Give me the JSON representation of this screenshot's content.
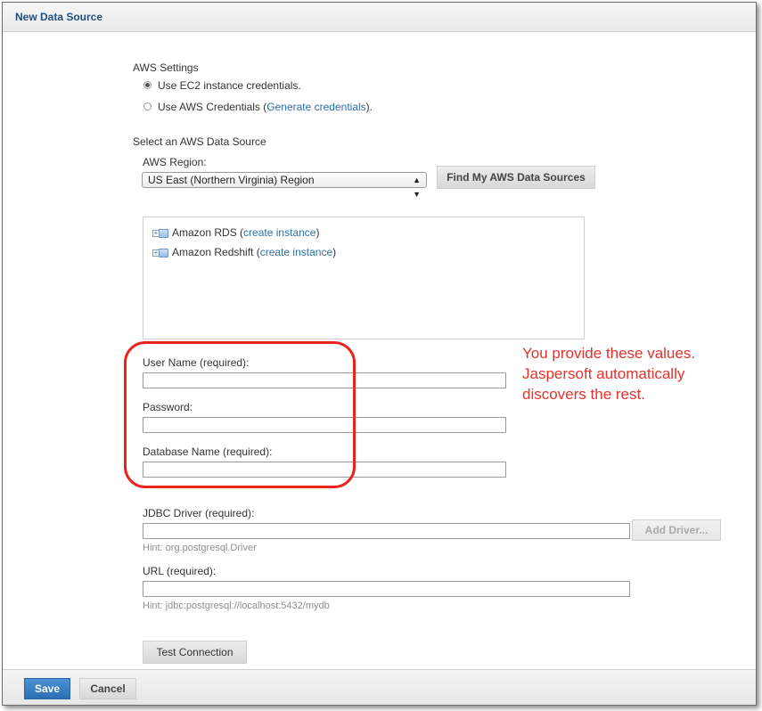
{
  "dialog": {
    "title": "New Data Source"
  },
  "aws_settings": {
    "heading": "AWS Settings",
    "options": [
      {
        "label": "Use EC2 instance credentials.",
        "checked": true
      },
      {
        "label_pre": "Use AWS Credentials (",
        "link": "Generate credentials",
        "label_post": ")."
      }
    ]
  },
  "data_source": {
    "heading": "Select an AWS Data Source",
    "region_label": "AWS Region:",
    "region_value": "US East (Northern Virginia) Region",
    "find_button": "Find My AWS Data Sources",
    "tree": [
      {
        "name": "Amazon RDS",
        "open": " (",
        "link": "create instance",
        "close": ")"
      },
      {
        "name": "Amazon Redshift",
        "open": " (",
        "link": "create instance",
        "close": ")"
      }
    ]
  },
  "form": {
    "username_label": "User Name (required):",
    "username_value": "",
    "password_label": "Password:",
    "password_value": "",
    "dbname_label": "Database Name (required):",
    "dbname_value": "",
    "jdbc_label": "JDBC Driver (required):",
    "jdbc_value": "",
    "add_driver_button": "Add Driver...",
    "jdbc_hint": "Hint: org.postgresql.Driver",
    "url_label": "URL (required):",
    "url_value": "",
    "url_hint": "Hint: jdbc:postgresql://localhost:5432/mydb",
    "test_button": "Test Connection"
  },
  "annotation": {
    "lines": [
      "You provide these values.",
      "Jaspersoft automatically",
      "discovers the rest."
    ],
    "color": "#e8312a"
  },
  "footer": {
    "save": "Save",
    "cancel": "Cancel"
  }
}
